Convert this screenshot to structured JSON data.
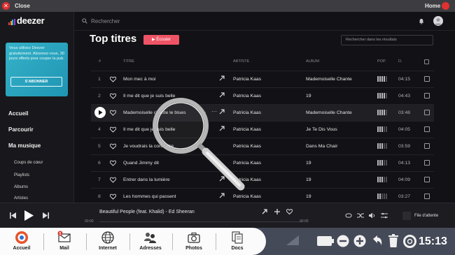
{
  "system_bar": {
    "close_label": "Close",
    "close_icon": "✕",
    "home_label": "Home"
  },
  "sidebar": {
    "logo_text": "deezer",
    "promo_text": "Vous utilisez Deezer gratuitement. Abonnez-vous, 30 jours offerts pour couper la pub.",
    "promo_button": "S'ABONNER",
    "main_nav": [
      "Accueil",
      "Parcourir",
      "Ma musique"
    ],
    "sub_nav": [
      "Coups de cœur",
      "Playlists",
      "Albums",
      "Artistes"
    ]
  },
  "header": {
    "search_placeholder": "Rechercher"
  },
  "page": {
    "title": "Top titres",
    "play_button": "Écouter",
    "results_search_placeholder": "Rechercher dans les résultats"
  },
  "table": {
    "headers": {
      "num": "#",
      "title": "TITRE",
      "artist": "ARTISTE",
      "album": "ALBUM",
      "pop": "POP.",
      "duration": "D."
    },
    "rows": [
      {
        "num": "1",
        "title": "Mon mec à moi",
        "artist": "Patricia Kaas",
        "album": "Mademoiselle Chante",
        "duration": "04:15",
        "pop": 0.8
      },
      {
        "num": "2",
        "title": "Il me dit que je suis belle",
        "artist": "Patricia Kaas",
        "album": "19",
        "duration": "04:43",
        "pop": 0.7
      },
      {
        "num": "3",
        "title": "Mademoiselle chante le blues",
        "artist": "Patricia Kaas",
        "album": "Mademoiselle Chante",
        "duration": "03:48",
        "pop": 0.7
      },
      {
        "num": "4",
        "title": "Il me dit que je suis belle",
        "artist": "Patricia Kaas",
        "album": "Je Te Dis Vous",
        "duration": "04:05",
        "pop": 0.6
      },
      {
        "num": "5",
        "title": "Je voudrais la connaître",
        "artist": "Patricia Kaas",
        "album": "Dans Ma Chair",
        "duration": "03:59",
        "pop": 0.5
      },
      {
        "num": "6",
        "title": "Quand Jimmy dit",
        "artist": "Patricia Kaas",
        "album": "19",
        "duration": "04:13",
        "pop": 0.5
      },
      {
        "num": "7",
        "title": "Entrer dans la lumière",
        "artist": "Patricia Kaas",
        "album": "19",
        "duration": "04:09",
        "pop": 0.5
      },
      {
        "num": "8",
        "title": "Les hommes qui passent",
        "artist": "Patricia Kaas",
        "album": "19",
        "duration": "03:27",
        "pop": 0.4
      }
    ]
  },
  "player": {
    "track": "Beautiful People (feat. Khalid) - Ed Sheeran",
    "time_start": "00:00",
    "time_end": "00:00",
    "queue_label": "File d'attente"
  },
  "dock": {
    "items": [
      "Accueil",
      "Mail",
      "Internet",
      "Adresses",
      "Photos",
      "Docs"
    ],
    "mail_badge": "5",
    "clock": "15:13"
  },
  "colors": {
    "accent": "#ef5466",
    "promo": "#2aa5bf",
    "dock_dark": "#454a58"
  }
}
